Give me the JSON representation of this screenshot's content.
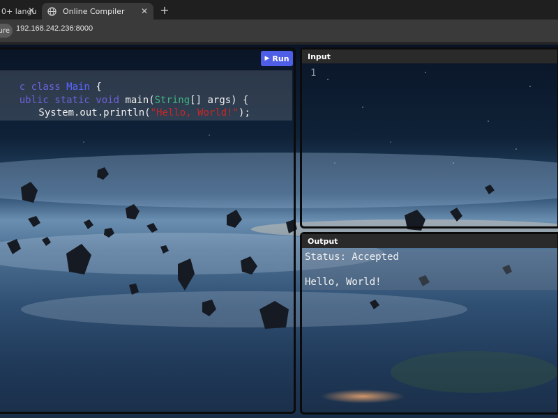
{
  "browser": {
    "tabs": [
      {
        "title": "0+ langu",
        "active": false
      },
      {
        "title": "Online Compiler",
        "active": true
      }
    ],
    "close_glyph": "✕",
    "new_tab_glyph": "+",
    "security_chip": "ure",
    "url": "192.168.242.236:8000"
  },
  "editor": {
    "run_label": "Run",
    "code": {
      "line1": {
        "kw": "c class",
        "cls": "Main",
        "rest": " {"
      },
      "line2": {
        "kw": "ublic static void",
        "plain": " main(",
        "type": "String",
        "rest": "[] args) {"
      },
      "line3": {
        "plain": "    System.out.println(",
        "str": "\"Hello, World!\"",
        "rest": ");"
      }
    }
  },
  "input": {
    "header": "Input",
    "line_number": "1"
  },
  "output": {
    "header": "Output",
    "status": "Status: Accepted",
    "result": "Hello, World!"
  },
  "colors": {
    "run_button": "#4e5ee6",
    "keyword": "#6b63d9",
    "class_name": "#5a66ff",
    "type": "#3fb37f",
    "string": "#c62828"
  }
}
